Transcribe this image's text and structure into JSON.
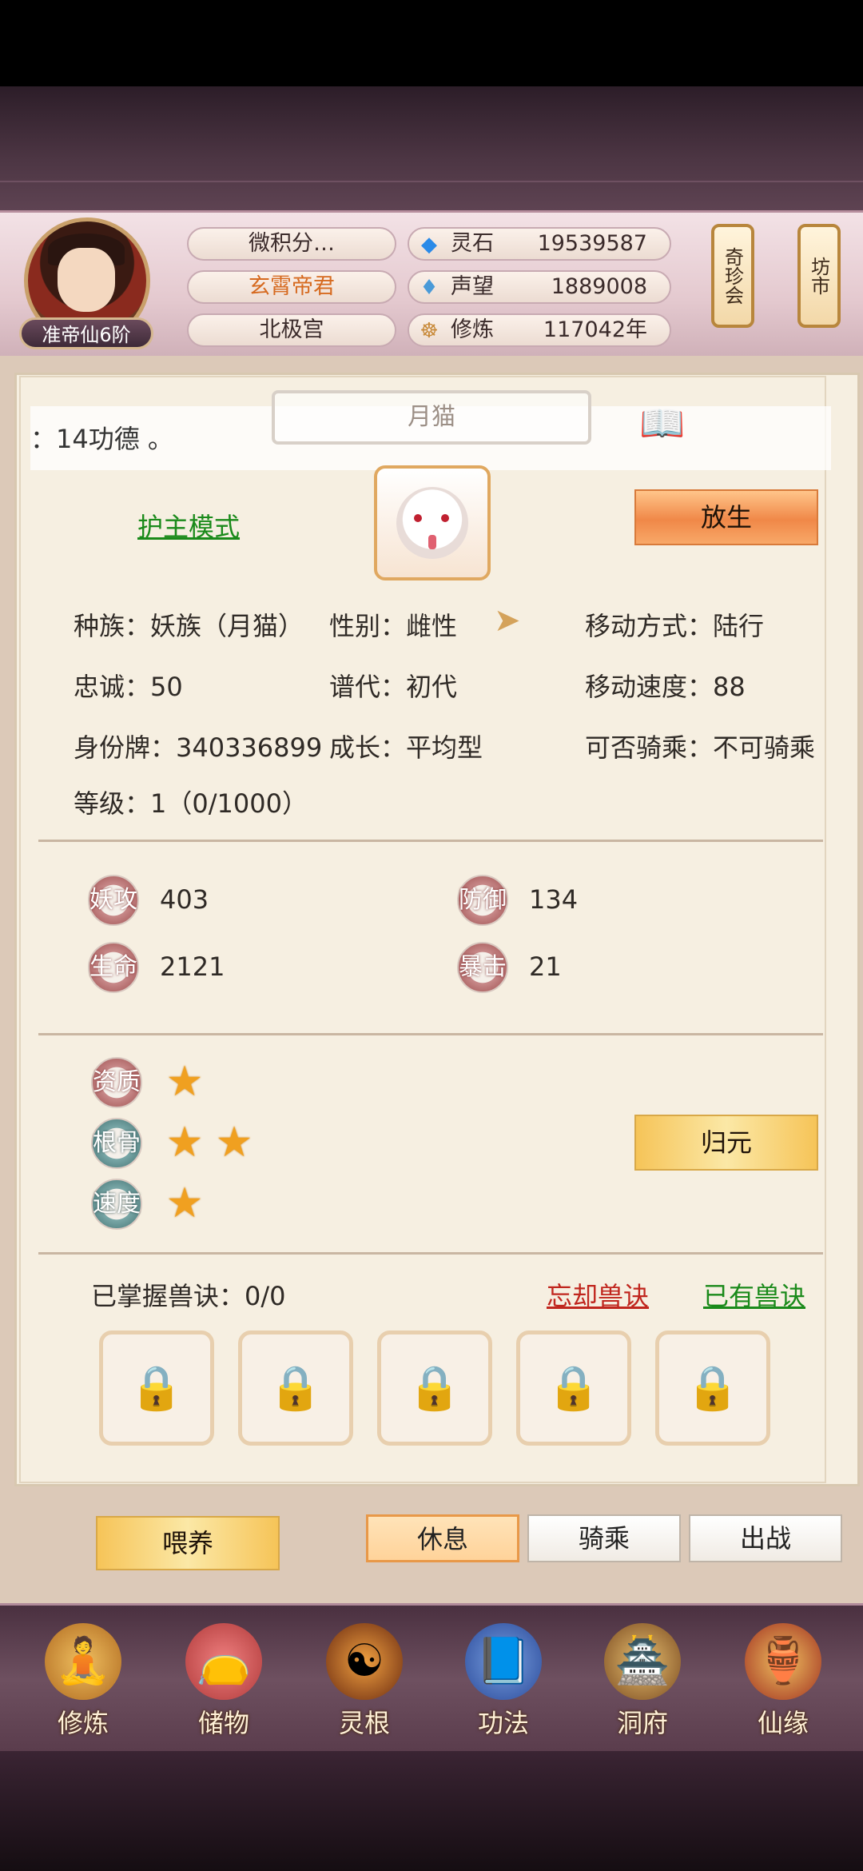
{
  "header": {
    "rank": "准帝仙6阶",
    "name_pills": [
      "微积分…",
      "玄霄帝君",
      "北极宫"
    ],
    "resources": [
      {
        "icon": "spirit-stone-icon",
        "label": "灵石",
        "value": "19539587"
      },
      {
        "icon": "reputation-icon",
        "label": "声望",
        "value": "1889008"
      },
      {
        "icon": "cultivation-icon",
        "label": "修炼",
        "value": "117042年"
      }
    ],
    "side_buttons": [
      "奇珍会",
      "坊市"
    ]
  },
  "panel": {
    "title": "月猫",
    "banner": "：14功德 。",
    "guard_mode": "护主模式",
    "release_button": "放生"
  },
  "attributes": {
    "race": "种族：妖族（月猫）",
    "gender": "性别：雌性",
    "move_mode": "移动方式：陆行",
    "loyalty": "忠诚：50",
    "lineage": "谱代：初代",
    "move_speed": "移动速度：88",
    "id_tag": "身份牌：340336899",
    "growth": "成长：平均型",
    "rideable": "可否骑乘：不可骑乘",
    "level": "等级：1（0/1000）"
  },
  "stats": [
    {
      "badge": "妖攻",
      "value": "403"
    },
    {
      "badge": "防御",
      "value": "134"
    },
    {
      "badge": "生命",
      "value": "2121"
    },
    {
      "badge": "暴击",
      "value": "21"
    }
  ],
  "qualities": [
    {
      "badge": "资质",
      "stars": 1
    },
    {
      "badge": "根骨",
      "stars": 2
    },
    {
      "badge": "速度",
      "stars": 1
    }
  ],
  "reset_button": "归元",
  "skills": {
    "mastered": "已掌握兽诀：0/0",
    "forget_link": "忘却兽诀",
    "owned_link": "已有兽诀"
  },
  "actions": {
    "feed": "喂养",
    "rest": "休息",
    "ride": "骑乘",
    "battle": "出战"
  },
  "nav": [
    "修炼",
    "储物",
    "灵根",
    "功法",
    "洞府",
    "仙缘"
  ],
  "colors": {
    "accent_orange": "#f08848",
    "link_green": "#1a8a1a",
    "link_red": "#c0261e"
  }
}
